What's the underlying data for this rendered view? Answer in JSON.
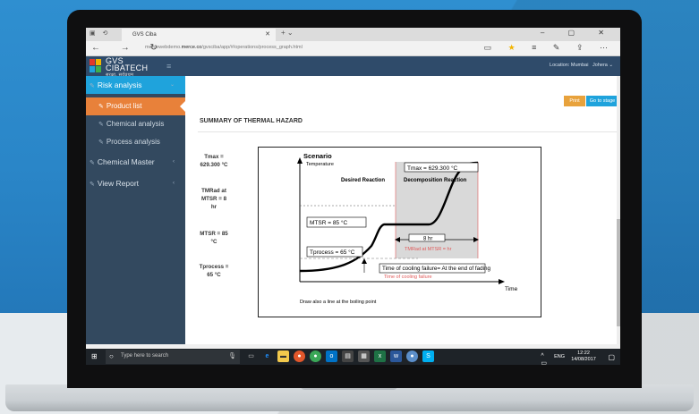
{
  "browser": {
    "tab_title": "GVS Ciba",
    "url_prefix": "mercewebdemo.",
    "url_domain": "merce.co",
    "url_path": "/gvsciba/app/#/operations/process_graph.html"
  },
  "header": {
    "logo_main": "GVS",
    "logo_line2": "CIBATECH",
    "logo_tag": "सुरक्षा, सर्वप्रथम",
    "location_label": "Location: Mumbai",
    "user": "Johera"
  },
  "sidebar": {
    "items": [
      {
        "label": "Risk analysis"
      },
      {
        "label": "Product list"
      },
      {
        "label": "Chemical analysis"
      },
      {
        "label": "Process analysis"
      },
      {
        "label": "Chemical Master"
      },
      {
        "label": "View Report"
      }
    ]
  },
  "main": {
    "print_label": "Print",
    "stage_label": "Go to stage",
    "title": "SUMMARY OF THERMAL HAZARD",
    "stats": [
      {
        "line1": "Tmax =",
        "line2": "629.300 °C"
      },
      {
        "line1": "TMRad at",
        "line2": "MTSR = 8",
        "line3": "hr"
      },
      {
        "line1": "MTSR = 85",
        "line2": "°C"
      },
      {
        "line1": "Tprocess =",
        "line2": "65 °C"
      }
    ]
  },
  "figure": {
    "scenario": "Scenario",
    "temperature": "Temperature",
    "desired_reaction": "Desired Reaction",
    "decomposition_reaction": "Decomposition Reaction",
    "tmax_box": "Tmax = 629.300 °C",
    "mtsr_box": "MTSR = 85 °C",
    "tprocess_box": "Tprocess = 65 °C",
    "hr_box": "8 hr",
    "tmrad_label": "TMRad at MTSR = hr",
    "cooling_failure": "Time of cooling failure= At the end of fading",
    "cooling_failure_red": "Time of cooling failure",
    "time_label": "Time",
    "footnote": "Draw also a line at the boiling point"
  },
  "taskbar": {
    "search_placeholder": "Type here to search",
    "lang": "ENG",
    "time": "12:22",
    "date": "14/08/2017"
  },
  "colors": {
    "sidebar_bg": "#33495f",
    "header_bg": "#2f4b6a",
    "active_blue": "#1fa3dc",
    "active_orange": "#e8813a",
    "print_btn": "#e8a23c"
  }
}
